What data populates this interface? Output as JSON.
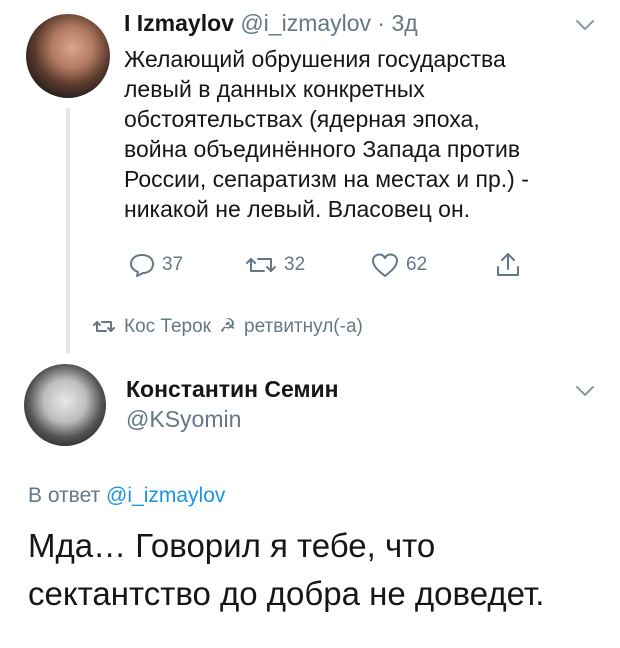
{
  "tweet1": {
    "display_name": "I Izmaylov",
    "handle": "@i_izmaylov",
    "separator": " · ",
    "time": "3д",
    "body": "Желающий обрушения государства\nлевый в данных конкретных\nобстоятельствах (ядерная эпоха,\nвойна объединённого Запада против\nРоссии, сепаратизм на местах и пр.) -\nникакой не левый. Власовец он.",
    "replies": "37",
    "retweets": "32",
    "likes": "62"
  },
  "retweet_notice": {
    "user": "Кос Терок",
    "symbol": "☭",
    "action": "ретвитнул(-а)"
  },
  "tweet2": {
    "display_name": "Константин Семин",
    "handle": "@KSyomin",
    "reply_prefix": "В ответ ",
    "reply_to": "@i_izmaylov",
    "body": "Мда… Говорил я тебе, что\nсектантство до добра не доведет."
  },
  "colors": {
    "text": "#14171a",
    "secondary": "#657786",
    "link": "#1b95e0",
    "thread_line": "#e1e8ed"
  }
}
